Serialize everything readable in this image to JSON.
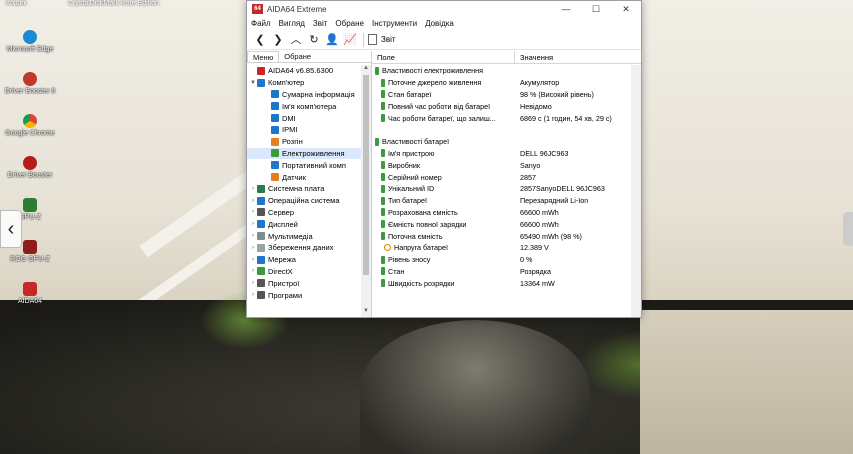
{
  "desktop": {
    "top_labels": [
      "Кошик",
      "CrystalDiskMark Kore Edition"
    ],
    "icons": [
      {
        "label": "Microsoft Edge",
        "color": "#1a8ad4"
      },
      {
        "label": "Driver Booster 8",
        "color": "#c0392b"
      },
      {
        "label": "Google Chrome",
        "color": "#e9b825"
      },
      {
        "label": "Driver Booster",
        "color": "#b71c1c"
      },
      {
        "label": "GPU-Z",
        "color": "#2e7d32"
      },
      {
        "label": "ROG GPU-Z",
        "color": "#8e1c1c"
      },
      {
        "label": "AIDA64",
        "color": "#c62828"
      }
    ]
  },
  "window": {
    "title": "AIDA64 Extreme",
    "app_icon": "64",
    "controls": {
      "minimize": "—",
      "maximize": "☐",
      "close": "✕"
    },
    "menu": [
      "Файл",
      "Вигляд",
      "Звіт",
      "Обране",
      "Інструменти",
      "Довідка"
    ],
    "toolbar": {
      "report_label": "Звіт"
    },
    "tabs": [
      "Меню",
      "Обране"
    ],
    "tree": [
      {
        "label": "AIDA64 v6.85.6300",
        "exp": "",
        "indent": 0,
        "color": "#c62828"
      },
      {
        "label": "Комп'ютер",
        "exp": "▼",
        "indent": 0,
        "color": "#1f77c9"
      },
      {
        "label": "Сумарна інформація",
        "exp": "",
        "indent": 2,
        "color": "#1f77c9"
      },
      {
        "label": "Ім'я комп'ютера",
        "exp": "",
        "indent": 2,
        "color": "#1f77c9"
      },
      {
        "label": "DMI",
        "exp": "",
        "indent": 2,
        "color": "#1f77c9"
      },
      {
        "label": "IPMI",
        "exp": "",
        "indent": 2,
        "color": "#1f77c9"
      },
      {
        "label": "Розгін",
        "exp": "",
        "indent": 2,
        "color": "#e67e22"
      },
      {
        "label": "Електроживлення",
        "exp": "",
        "indent": 2,
        "color": "#3d9b3d",
        "selected": true
      },
      {
        "label": "Портативний комп",
        "exp": "",
        "indent": 2,
        "color": "#1f77c9"
      },
      {
        "label": "Датчик",
        "exp": "",
        "indent": 2,
        "color": "#e67e22"
      },
      {
        "label": "Системна плата",
        "exp": "›",
        "indent": 0,
        "color": "#2b7a4b"
      },
      {
        "label": "Операційна система",
        "exp": "›",
        "indent": 0,
        "color": "#1f77c9"
      },
      {
        "label": "Сервер",
        "exp": "›",
        "indent": 0,
        "color": "#555"
      },
      {
        "label": "Дисплей",
        "exp": "›",
        "indent": 0,
        "color": "#1f77c9"
      },
      {
        "label": "Мультимедіа",
        "exp": "›",
        "indent": 0,
        "color": "#7f8c8d"
      },
      {
        "label": "Збереження даних",
        "exp": "›",
        "indent": 0,
        "color": "#95a5a6"
      },
      {
        "label": "Мережа",
        "exp": "›",
        "indent": 0,
        "color": "#1f77c9"
      },
      {
        "label": "DirectX",
        "exp": "›",
        "indent": 0,
        "color": "#3d9b3d"
      },
      {
        "label": "Пристрої",
        "exp": "›",
        "indent": 0,
        "color": "#555"
      },
      {
        "label": "Програми",
        "exp": "›",
        "indent": 0,
        "color": "#555"
      }
    ],
    "columns": {
      "field": "Поле",
      "value": "Значення"
    },
    "sections": [
      {
        "title": "Властивості електроживлення",
        "rows": [
          {
            "field": "Поточне джерело живлення",
            "value": "Акумулятор"
          },
          {
            "field": "Стан батареї",
            "value": "98 % (Високий рівень)"
          },
          {
            "field": "Повний час роботи від батареї",
            "value": "Невідомо"
          },
          {
            "field": "Час роботи батареї, що залиш...",
            "value": "6869 с (1 годин, 54 хв, 29 с)"
          }
        ]
      },
      {
        "title": "Властивості батареї",
        "rows": [
          {
            "field": "Ім'я пристрою",
            "value": "DELL 96JC963"
          },
          {
            "field": "Виробник",
            "value": "Sanyo"
          },
          {
            "field": "Серійний номер",
            "value": "2857"
          },
          {
            "field": "Унікальний ID",
            "value": "2857SanyoDELL 96JC963"
          },
          {
            "field": "Тип батареї",
            "value": "Перезарядний Li-Ion"
          },
          {
            "field": "Розрахована ємність",
            "value": "66600 mWh"
          },
          {
            "field": "Ємність повної зарядки",
            "value": "66600 mWh"
          },
          {
            "field": "Поточна ємність",
            "value": "65490 mWh  (98 %)"
          },
          {
            "field": "Напруга батареї",
            "value": "12.389 V",
            "icon": "volt"
          },
          {
            "field": "Рівень зносу",
            "value": "0 %"
          },
          {
            "field": "Стан",
            "value": "Розрядка"
          },
          {
            "field": "Швидкість розрядки",
            "value": "13364 mW"
          }
        ]
      }
    ]
  }
}
